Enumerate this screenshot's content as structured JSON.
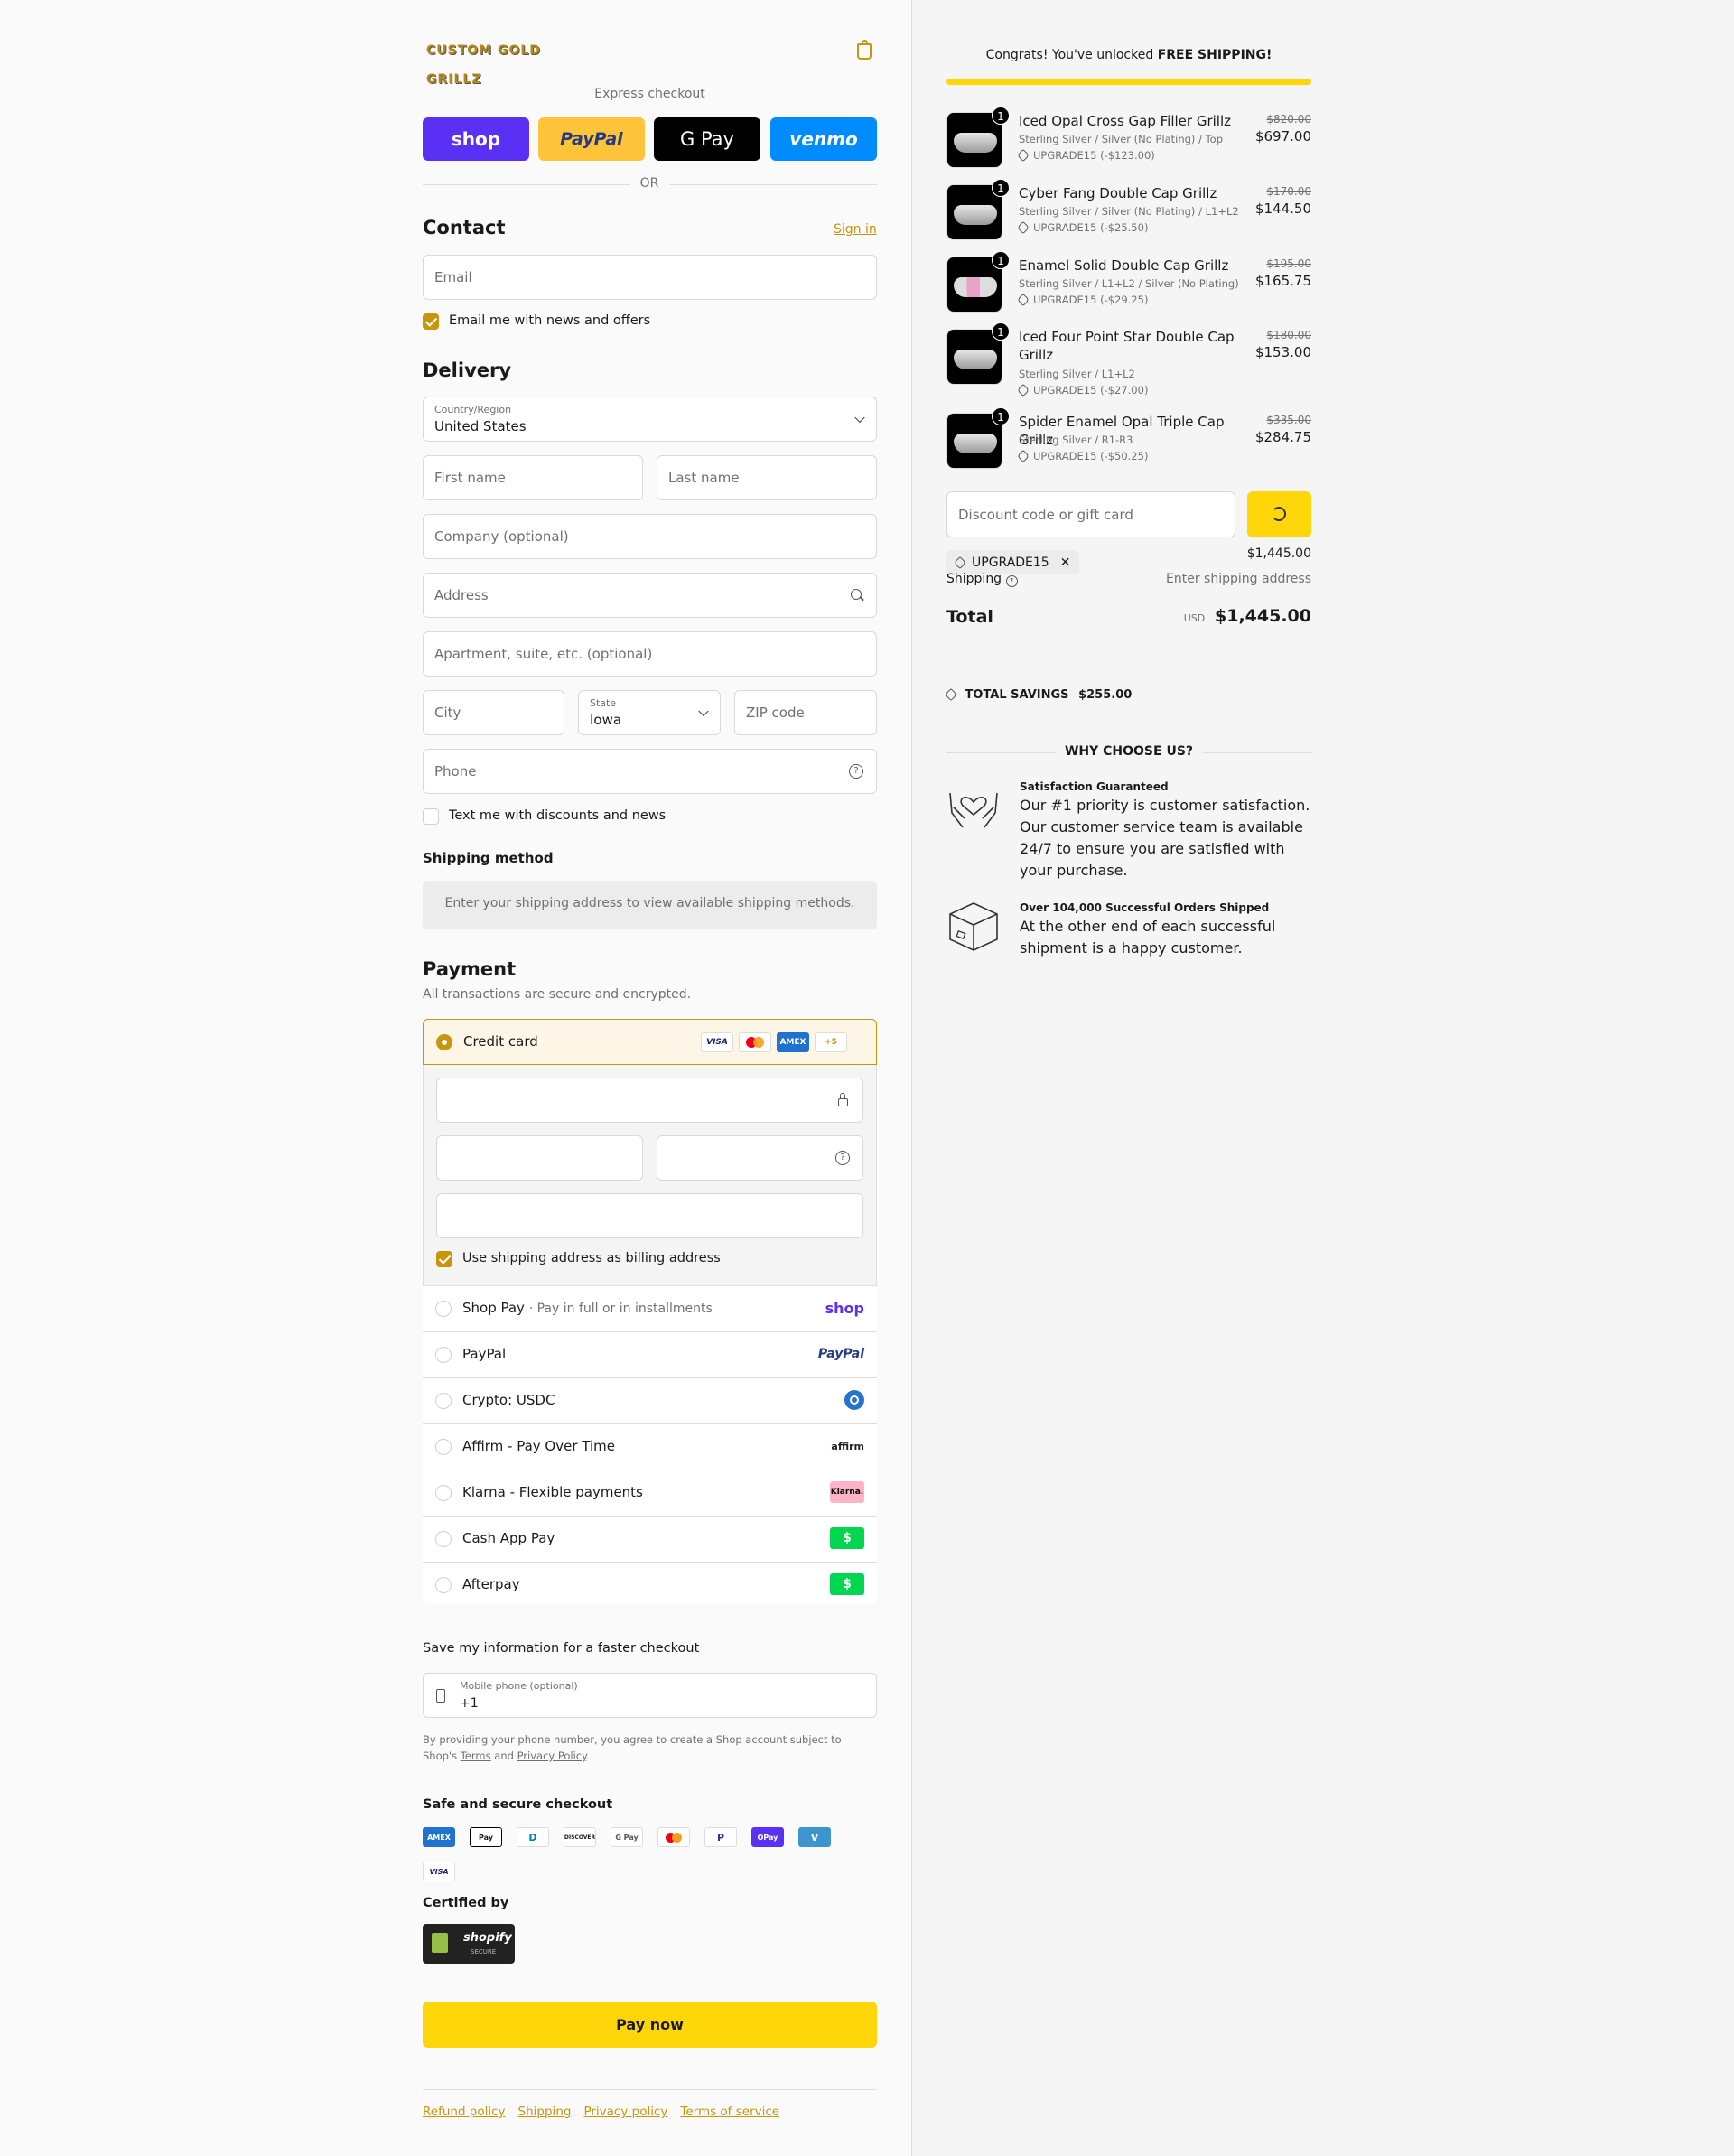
{
  "brand": {
    "logo_text": "CUSTOM GOLD GRILLZ",
    "accent": "#c9950e",
    "pay_button_color": "#ffd60a"
  },
  "express": {
    "label": "Express checkout",
    "buttons": [
      "shop",
      "PayPal",
      "G Pay",
      "venmo"
    ],
    "or": "OR"
  },
  "contact": {
    "title": "Contact",
    "sign_in": "Sign in",
    "email_placeholder": "Email",
    "news_label": "Email me with news and offers",
    "news_checked": true
  },
  "delivery": {
    "title": "Delivery",
    "country_label": "Country/Region",
    "country_value": "United States",
    "first_name": "First name",
    "last_name": "Last name",
    "company": "Company (optional)",
    "address": "Address",
    "apartment": "Apartment, suite, etc. (optional)",
    "city": "City",
    "state_label": "State",
    "state_value": "Iowa",
    "zip": "ZIP code",
    "phone": "Phone",
    "text_label": "Text me with discounts and news",
    "text_checked": false
  },
  "shipping_method": {
    "title": "Shipping method",
    "message": "Enter your shipping address to view available shipping methods."
  },
  "payment": {
    "title": "Payment",
    "subtitle": "All transactions are secure and encrypted.",
    "credit_card_label": "Credit card",
    "card_brands": [
      "VISA",
      "Mastercard",
      "AMEX",
      "+5"
    ],
    "billing_label": "Use shipping address as billing address",
    "billing_checked": true,
    "methods": [
      {
        "label": "Shop Pay",
        "sub": "· Pay in full or in installments",
        "icon": "shop"
      },
      {
        "label": "PayPal",
        "sub": "",
        "icon": "PayPal"
      },
      {
        "label": "Crypto: USDC",
        "sub": "",
        "icon": "usdc-icon"
      },
      {
        "label": "Affirm - Pay Over Time",
        "sub": "",
        "icon": "affirm"
      },
      {
        "label": "Klarna - Flexible payments",
        "sub": "",
        "icon": "Klarna."
      },
      {
        "label": "Cash App Pay",
        "sub": "",
        "icon": "$"
      },
      {
        "label": "Afterpay",
        "sub": "",
        "icon": "$"
      }
    ]
  },
  "save_info": {
    "title": "Save my information for a faster checkout",
    "mobile_label": "Mobile phone (optional)",
    "mobile_prefix": "+1",
    "legal_1": "By providing your phone number, you agree to create a Shop account subject to",
    "legal_2_prefix": "Shop's",
    "terms": "Terms",
    "and": "and",
    "privacy": "Privacy Policy",
    "legal_end": "."
  },
  "secure": {
    "title": "Safe and secure checkout",
    "methods": [
      "AMEX",
      "Pay",
      "D",
      "DISCOVER",
      "G Pay",
      "MC",
      "P",
      "OPay",
      "V",
      "VISA"
    ],
    "certified": "Certified by",
    "badge_line1": "shopify",
    "badge_line2": "SECURE"
  },
  "pay_now": "Pay now",
  "footer_links": [
    "Refund policy",
    "Shipping",
    "Privacy policy",
    "Terms of service"
  ],
  "summary": {
    "banner_prefix": "Congrats! You've unlocked",
    "banner_bold": "FREE SHIPPING!",
    "progress_fraction": 1.0,
    "items": [
      {
        "qty": "1",
        "name": "Iced Opal Cross Gap Filler Grillz",
        "variant": "Sterling Silver / Silver (No Plating) / Top",
        "discount": "UPGRADE15 (-$123.00)",
        "old": "$820.00",
        "price": "$697.00"
      },
      {
        "qty": "1",
        "name": "Cyber Fang Double Cap Grillz",
        "variant": "Sterling Silver / Silver (No Plating) / L1+L2",
        "discount": "UPGRADE15 (-$25.50)",
        "old": "$170.00",
        "price": "$144.50"
      },
      {
        "qty": "1",
        "name": "Enamel Solid Double Cap Grillz",
        "variant": "Sterling Silver / L1+L2 / Silver (No Plating)",
        "discount": "UPGRADE15 (-$29.25)",
        "old": "$195.00",
        "price": "$165.75"
      },
      {
        "qty": "1",
        "name": "Iced Four Point Star Double Cap Grillz",
        "variant": "Sterling Silver / L1+L2",
        "discount": "UPGRADE15 (-$27.00)",
        "old": "$180.00",
        "price": "$153.00"
      },
      {
        "qty": "1",
        "name": "Spider Enamel Opal Triple Cap Grillz",
        "variant": "Sterling Silver / R1-R3",
        "discount": "UPGRADE15 (-$50.25)",
        "old": "$335.00",
        "price": "$284.75"
      }
    ],
    "discount_placeholder": "Discount code or gift card",
    "code_chip": "UPGRADE15",
    "subtotal_value": "$1,445.00",
    "shipping_label": "Shipping",
    "shipping_value": "Enter shipping address",
    "total_label": "Total",
    "currency": "USD",
    "total_value": "$1,445.00",
    "savings_label": "TOTAL SAVINGS",
    "savings_value": "$255.00",
    "why_title": "WHY CHOOSE US?",
    "why": [
      {
        "title": "Satisfaction Guaranteed",
        "text": "Our #1 priority is customer satisfaction. Our customer service team is available 24/7 to ensure you are satisfied with your purchase."
      },
      {
        "title": "Over 104,000 Successful Orders Shipped",
        "text": "At the other end of each successful shipment is a happy customer."
      }
    ]
  }
}
